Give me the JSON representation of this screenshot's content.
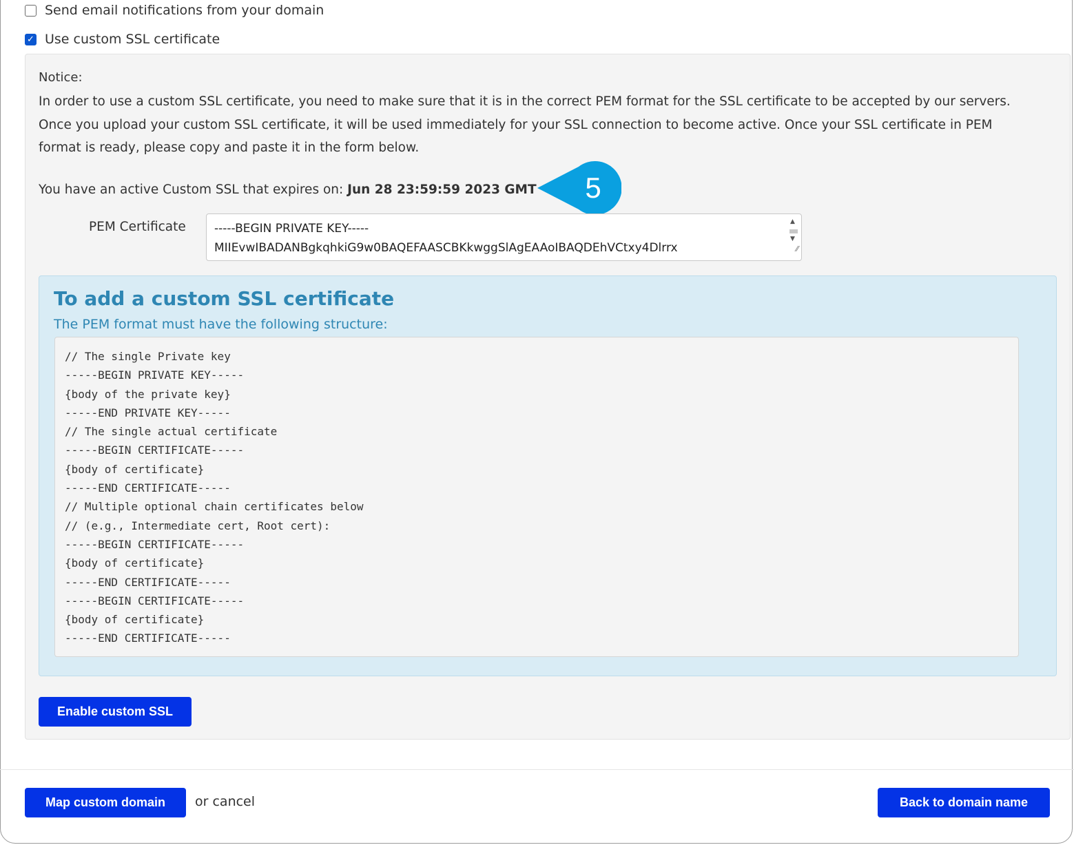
{
  "options": {
    "email_notifications": {
      "label": "Send email notifications from your domain",
      "checked": false
    },
    "custom_ssl": {
      "label": "Use custom SSL certificate",
      "checked": true
    }
  },
  "notice": {
    "title": "Notice:",
    "body": "In order to use a custom SSL certificate, you need to make sure that it is in the correct PEM format for the SSL certificate to be accepted by our servers. Once you upload your custom SSL certificate, it will be used immediately for your SSL connection to become active. Once your SSL certificate in PEM format is ready, please copy and paste it in the form below."
  },
  "active_ssl": {
    "prefix": "You have an active Custom SSL that expires on: ",
    "expiry": "Jun 28 23:59:59 2023 GMT"
  },
  "callout": {
    "number": "5",
    "color": "#0aa0e0"
  },
  "pem": {
    "label": "PEM Certificate",
    "value_lines": [
      "-----BEGIN PRIVATE KEY-----",
      "MIIEvwIBADANBgkqhkiG9w0BAQEFAASCBKkwggSlAgEAAoIBAQDEhVCtxy4Dlrrx"
    ]
  },
  "info": {
    "title": "To add a custom SSL certificate",
    "subtitle": "The PEM format must have the following structure:",
    "code_lines": [
      "// The single Private key",
      "-----BEGIN PRIVATE KEY-----",
      "{body of the private key}",
      "-----END PRIVATE KEY-----",
      "// The single actual certificate",
      "-----BEGIN CERTIFICATE-----",
      "{body of certificate}",
      "-----END CERTIFICATE-----",
      "// Multiple optional chain certificates below",
      "// (e.g., Intermediate cert, Root cert):",
      "-----BEGIN CERTIFICATE-----",
      "{body of certificate}",
      "-----END CERTIFICATE-----",
      "-----BEGIN CERTIFICATE-----",
      "{body of certificate}",
      "-----END CERTIFICATE-----"
    ]
  },
  "buttons": {
    "enable_ssl": "Enable custom SSL",
    "map_domain": "Map custom domain",
    "or_cancel": "or cancel",
    "back": "Back to domain name"
  },
  "colors": {
    "primary_button": "#0433e6",
    "info_accent": "#2e86b3"
  }
}
